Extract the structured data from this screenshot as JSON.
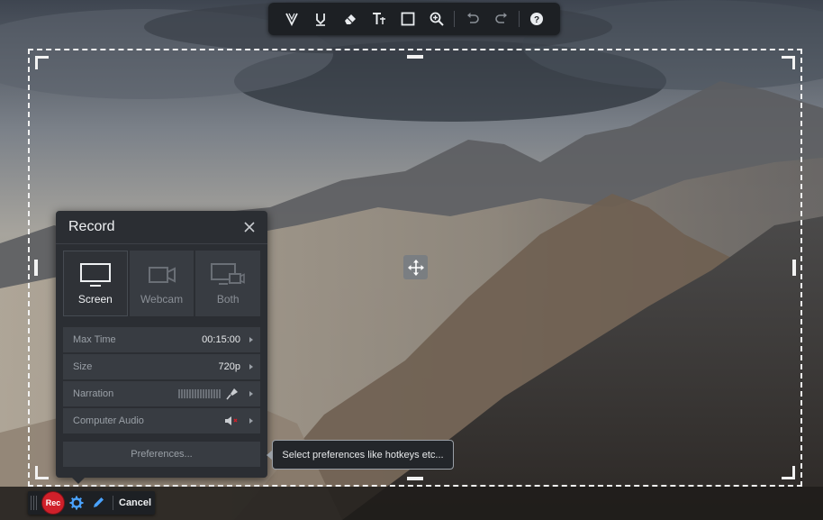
{
  "toolbar": {
    "tools": [
      {
        "icon": "pen-icon"
      },
      {
        "icon": "highlighter-icon"
      },
      {
        "icon": "eraser-icon"
      },
      {
        "icon": "text-tool-icon"
      },
      {
        "icon": "rectangle-icon"
      },
      {
        "icon": "zoom-icon"
      },
      {
        "icon": "undo-icon"
      },
      {
        "icon": "redo-icon"
      },
      {
        "icon": "help-icon"
      }
    ]
  },
  "panel": {
    "title": "Record",
    "modes": [
      {
        "label": "Screen",
        "icon": "monitor-icon",
        "active": true
      },
      {
        "label": "Webcam",
        "icon": "webcam-icon",
        "active": false
      },
      {
        "label": "Both",
        "icon": "screen-webcam-icon",
        "active": false
      }
    ],
    "settings": {
      "max_time_label": "Max Time",
      "max_time_value": "00:15:00",
      "size_label": "Size",
      "size_value": "720p",
      "narration_label": "Narration",
      "computer_audio_label": "Computer Audio"
    },
    "preferences_label": "Preferences..."
  },
  "tooltip": {
    "text": "Select preferences like hotkeys etc..."
  },
  "bottombar": {
    "rec_label": "Rec",
    "cancel_label": "Cancel"
  },
  "colors": {
    "accent_red": "#d0202a",
    "panel_bg": "#2b2e33",
    "toolbar_bg": "#1d2024"
  }
}
